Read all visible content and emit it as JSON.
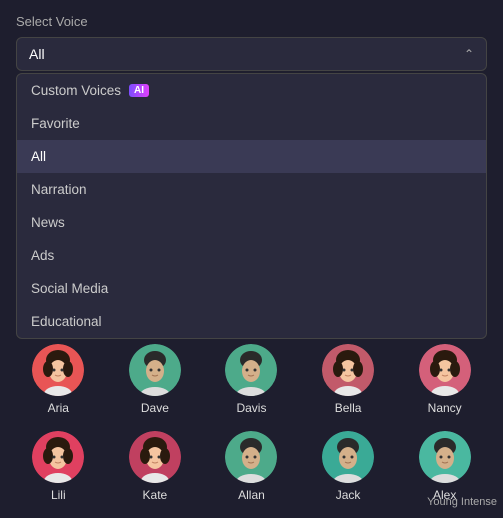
{
  "label": "Select Voice",
  "dropdown": {
    "selected": "All",
    "items": [
      {
        "id": "custom",
        "label": "Custom Voices",
        "badge": "AI",
        "active": false
      },
      {
        "id": "favorite",
        "label": "Favorite",
        "active": false
      },
      {
        "id": "all",
        "label": "All",
        "active": true
      },
      {
        "id": "narration",
        "label": "Narration",
        "active": false
      },
      {
        "id": "news",
        "label": "News",
        "active": false
      },
      {
        "id": "ads",
        "label": "Ads",
        "active": false
      },
      {
        "id": "social-media",
        "label": "Social Media",
        "active": false
      },
      {
        "id": "educational",
        "label": "Educational",
        "active": false
      }
    ]
  },
  "voices": {
    "row1": [
      {
        "id": "aria",
        "name": "Aria",
        "gender": "female",
        "color": "#e85555"
      },
      {
        "id": "dave",
        "name": "Dave",
        "gender": "male",
        "color": "#4daa8a"
      },
      {
        "id": "davis",
        "name": "Davis",
        "gender": "male",
        "color": "#4daa8a"
      },
      {
        "id": "bella",
        "name": "Bella",
        "gender": "female",
        "color": "#c25a6a"
      },
      {
        "id": "nancy",
        "name": "Nancy",
        "gender": "female",
        "color": "#d4607a"
      }
    ],
    "row2": [
      {
        "id": "lili",
        "name": "Lili",
        "gender": "female",
        "color": "#e04060"
      },
      {
        "id": "kate",
        "name": "Kate",
        "gender": "female",
        "color": "#c04060"
      },
      {
        "id": "allan",
        "name": "Allan",
        "gender": "male",
        "color": "#4daa8a"
      },
      {
        "id": "jack",
        "name": "Jack",
        "gender": "male",
        "color": "#3aaa96"
      },
      {
        "id": "alex",
        "name": "Alex",
        "gender": "male",
        "color": "#4ab8a0"
      }
    ],
    "tagline": "Young Intense"
  }
}
